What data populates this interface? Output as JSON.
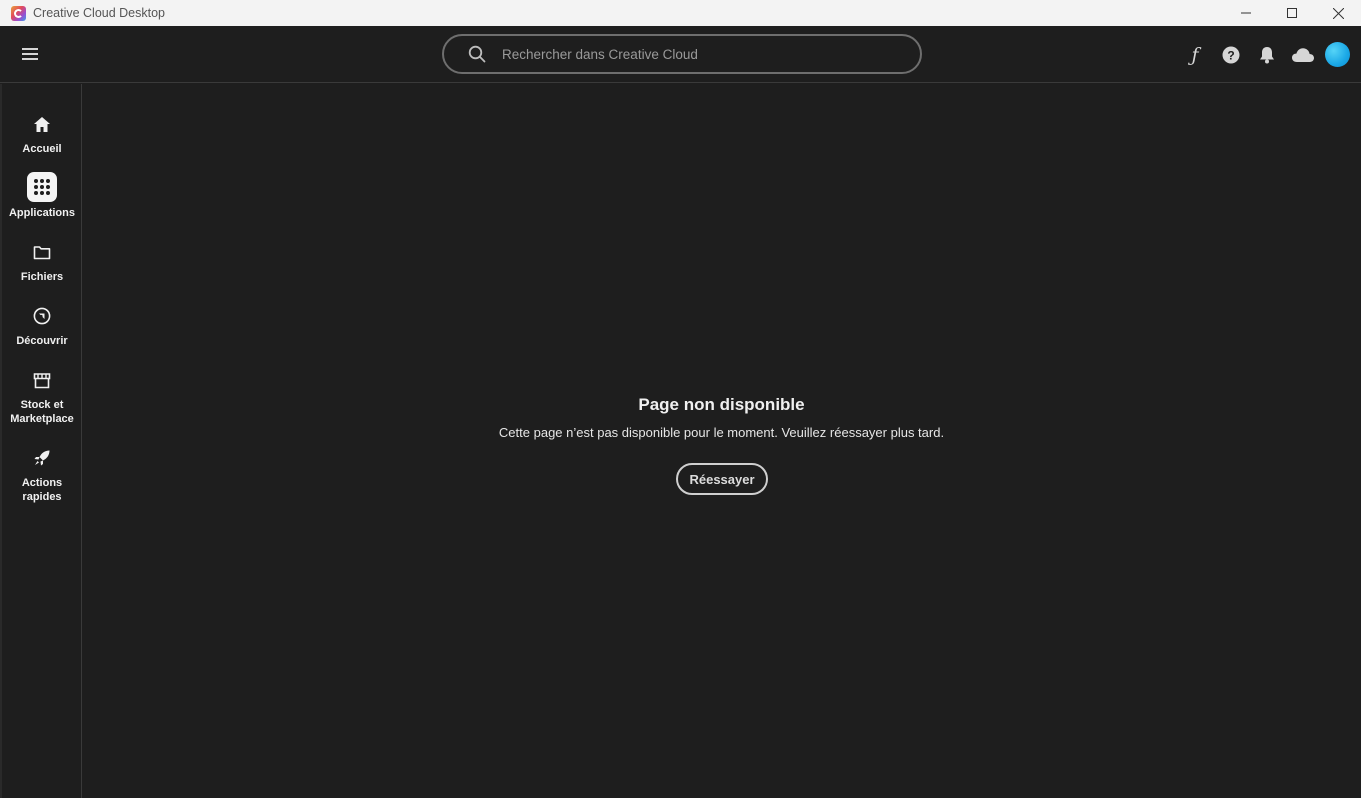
{
  "window": {
    "title": "Creative Cloud Desktop"
  },
  "header": {
    "search_placeholder": "Rechercher dans Creative Cloud",
    "icons": [
      "fonts-icon",
      "help-icon",
      "notifications-bell-icon",
      "cloud-icon",
      "avatar"
    ]
  },
  "sidebar": {
    "items": [
      {
        "label": "Accueil",
        "icon": "home-icon",
        "active": false
      },
      {
        "label": "Applications",
        "icon": "apps-grid-icon",
        "active": true
      },
      {
        "label": "Fichiers",
        "icon": "folder-icon",
        "active": false
      },
      {
        "label": "Découvrir",
        "icon": "compass-icon",
        "active": false
      },
      {
        "label": "Stock et Marketplace",
        "icon": "store-icon",
        "active": false
      },
      {
        "label": "Actions rapides",
        "icon": "rocket-icon",
        "active": false
      }
    ]
  },
  "main": {
    "error_title": "Page non disponible",
    "error_message": "Cette page n’est pas disponible pour le moment. Veuillez réessayer plus tard.",
    "retry_label": "Réessayer"
  },
  "colors": {
    "background": "#1e1e1e",
    "avatar": "#1aa7e6"
  }
}
